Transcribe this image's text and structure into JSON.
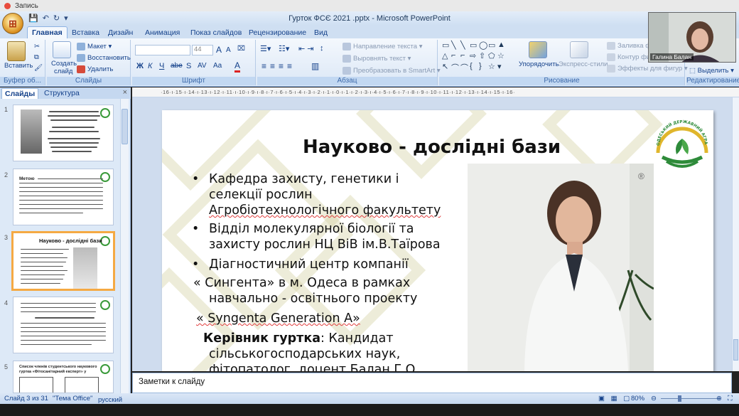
{
  "recording": {
    "label": "Запись"
  },
  "window": {
    "title": "Гурток ФСЄ 2021 .pptx - Microsoft PowerPoint"
  },
  "tabs": [
    "Главная",
    "Вставка",
    "Дизайн",
    "Анимация",
    "Показ слайдов",
    "Рецензирование",
    "Вид"
  ],
  "ribbon": {
    "clipboard": {
      "paste": "Вставить",
      "label": "Буфер об..."
    },
    "slides": {
      "create": "Создать",
      "create2": "слайд",
      "layout": "Макет",
      "reset": "Восстановить",
      "delete": "Удалить",
      "label": "Слайды"
    },
    "font": {
      "size": "44",
      "label": "Шрифт",
      "bold": "Ж",
      "italic": "К",
      "underline": "Ч",
      "strike": "abe",
      "shadow": "S",
      "spacing": "AV",
      "case": "Aa",
      "color": "A",
      "grow": "A",
      "shrink": "A"
    },
    "paragraph": {
      "direction": "Направление текста",
      "align": "Выровнять текст",
      "smartart": "Преобразовать в SmartArt",
      "label": "Абзац"
    },
    "drawing": {
      "arrange": "Упорядочить",
      "styles": "Экспресс-стили",
      "fill": "Заливка фи",
      "outline": "Контур фи",
      "effects": "Эффекты для фигур",
      "label": "Рисование"
    },
    "editing": {
      "select": "Выделить",
      "label": "Редактирование"
    }
  },
  "panel": {
    "tab_slides": "Слайды",
    "tab_outline": "Структура",
    "close": "×",
    "thumbs": [
      "1",
      "2",
      "3",
      "4",
      "5"
    ],
    "thumb3_title": "Науково - дослідні бази",
    "thumb2_title": "Метою",
    "thumb5_title": "Список членів студентського наукового гуртка «Фітосанітарний експерт» у 2021/2022 н.р."
  },
  "ruler": "·16·ı·15·ı·14·ı·13·ı·12·ı·11·ı·10·ı·9·ı·8·ı·7·ı·6·ı·5·ı·4·ı·3·ı·2·ı·1·ı·0·ı·1·ı·2·ı·3·ı·4·ı·5·ı·6·ı·7·ı·8·ı·9·ı·10·ı·11·ı·12·ı·13·ı·14·ı·15·ı·16·",
  "slide": {
    "title": "Науково - дослідні бази",
    "bullets": [
      {
        "line1": "Кафедра захисту, генетики і",
        "line2": "селекції рослин",
        "line3": "Агробіотехнологічного факультету"
      },
      {
        "line1": "Відділ молекулярної біології та",
        "line2": "захисту рослин НЦ ВіВ ім.В.Таїрова"
      },
      {
        "line1": " Діагностичний центр компанії"
      }
    ],
    "syngenta1": "« Сингента» в м. Одеса в рамках",
    "syngenta2": "навчально - освітнього проекту",
    "syngenta3": "« Syngenta Generation A»",
    "leader_label": "Керівник гуртка",
    "leader_rest": ": Кандидат",
    "leader2": "сільськогосподарських наук,",
    "leader3": "фітопатолог, доцент Балан Г.О.",
    "bullet_char": "•",
    "logo_text": "ОДЕСЬКИЙ ДЕРЖАВНИЙ АГРАРНИЙ УНІВЕРСИТЕТ",
    "registered": "®"
  },
  "notes": {
    "placeholder": "Заметки к слайду"
  },
  "status": {
    "slide": "Слайд 3 из 31",
    "theme": "\"Тема Office\"",
    "lang": "русский",
    "zoom": "80%"
  },
  "webcam": {
    "name": "Галина Балан"
  },
  "colors": {
    "accent_orange": "#f5a943",
    "ribbon_blue": "#15428b",
    "logo_green": "#2e8b3a",
    "logo_yellow": "#e0b62c"
  }
}
